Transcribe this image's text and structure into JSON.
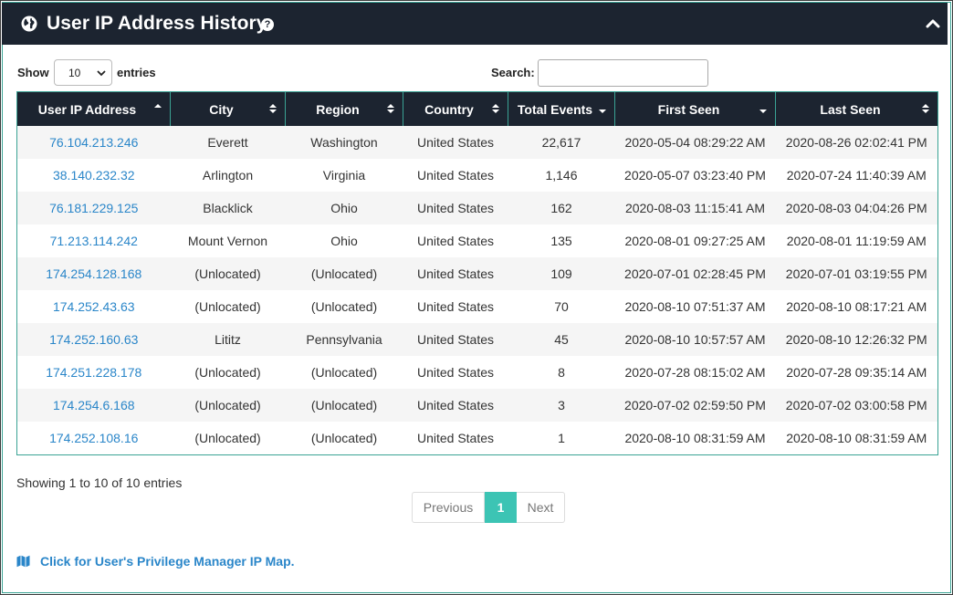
{
  "panel": {
    "title": "User IP Address History",
    "help_icon": "question-circle-icon",
    "collapse_icon": "chevron-up-icon",
    "title_icon": "globe-icon"
  },
  "controls": {
    "show_label": "Show",
    "entries_value": "10",
    "entries_label": "entries",
    "search_label": "Search:",
    "search_value": ""
  },
  "table": {
    "columns": [
      "User IP Address",
      "City",
      "Region",
      "Country",
      "Total Events",
      "First Seen",
      "Last Seen"
    ],
    "sort_indicators": [
      "asc",
      "both",
      "both",
      "both",
      "desc",
      "desc",
      "both"
    ],
    "rows": [
      {
        "ip": "76.104.213.246",
        "city": "Everett",
        "region": "Washington",
        "country": "United States",
        "events": "22,617",
        "first": "2020-05-04 08:29:22 AM",
        "last": "2020-08-26 02:02:41 PM"
      },
      {
        "ip": "38.140.232.32",
        "city": "Arlington",
        "region": "Virginia",
        "country": "United States",
        "events": "1,146",
        "first": "2020-05-07 03:23:40 PM",
        "last": "2020-07-24 11:40:39 AM"
      },
      {
        "ip": "76.181.229.125",
        "city": "Blacklick",
        "region": "Ohio",
        "country": "United States",
        "events": "162",
        "first": "2020-08-03 11:15:41 AM",
        "last": "2020-08-03 04:04:26 PM"
      },
      {
        "ip": "71.213.114.242",
        "city": "Mount Vernon",
        "region": "Ohio",
        "country": "United States",
        "events": "135",
        "first": "2020-08-01 09:27:25 AM",
        "last": "2020-08-01 11:19:59 AM"
      },
      {
        "ip": "174.254.128.168",
        "city": "(Unlocated)",
        "region": "(Unlocated)",
        "country": "United States",
        "events": "109",
        "first": "2020-07-01 02:28:45 PM",
        "last": "2020-07-01 03:19:55 PM"
      },
      {
        "ip": "174.252.43.63",
        "city": "(Unlocated)",
        "region": "(Unlocated)",
        "country": "United States",
        "events": "70",
        "first": "2020-08-10 07:51:37 AM",
        "last": "2020-08-10 08:17:21 AM"
      },
      {
        "ip": "174.252.160.63",
        "city": "Lititz",
        "region": "Pennsylvania",
        "country": "United States",
        "events": "45",
        "first": "2020-08-10 10:57:57 AM",
        "last": "2020-08-10 12:26:32 PM"
      },
      {
        "ip": "174.251.228.178",
        "city": "(Unlocated)",
        "region": "(Unlocated)",
        "country": "United States",
        "events": "8",
        "first": "2020-07-28 08:15:02 AM",
        "last": "2020-07-28 09:35:14 AM"
      },
      {
        "ip": "174.254.6.168",
        "city": "(Unlocated)",
        "region": "(Unlocated)",
        "country": "United States",
        "events": "3",
        "first": "2020-07-02 02:59:50 PM",
        "last": "2020-07-02 03:00:58 PM"
      },
      {
        "ip": "174.252.108.16",
        "city": "(Unlocated)",
        "region": "(Unlocated)",
        "country": "United States",
        "events": "1",
        "first": "2020-08-10 08:31:59 AM",
        "last": "2020-08-10 08:31:59 AM"
      }
    ]
  },
  "footer": {
    "info": "Showing 1 to 10 of 10 entries",
    "pagination": {
      "previous": "Previous",
      "current": "1",
      "next": "Next"
    },
    "map_link": "Click for User's Privilege Manager IP Map.",
    "map_icon": "map-icon"
  },
  "colors": {
    "header_bg": "#1c2430",
    "accent_teal": "#3cc4b4",
    "border_teal": "#3aa394",
    "link_blue": "#2a86c9"
  }
}
